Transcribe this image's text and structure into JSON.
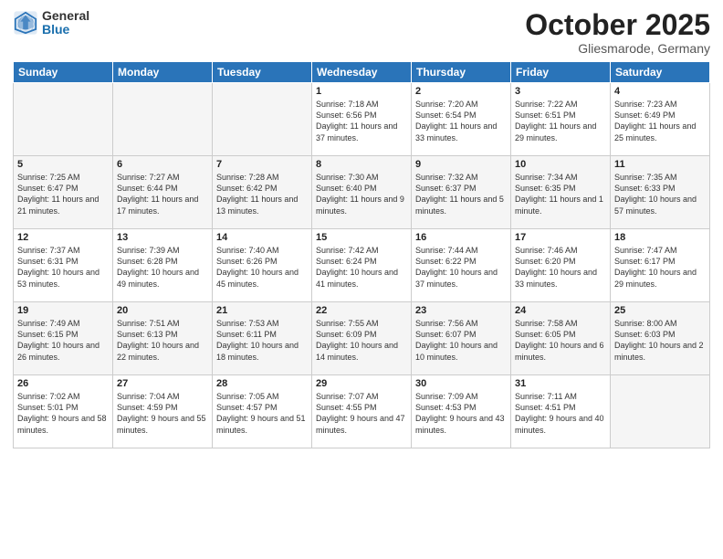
{
  "logo": {
    "general": "General",
    "blue": "Blue"
  },
  "title": "October 2025",
  "location": "Gliesmarode, Germany",
  "days_of_week": [
    "Sunday",
    "Monday",
    "Tuesday",
    "Wednesday",
    "Thursday",
    "Friday",
    "Saturday"
  ],
  "weeks": [
    [
      {
        "day": "",
        "info": "",
        "empty": true
      },
      {
        "day": "",
        "info": "",
        "empty": true
      },
      {
        "day": "",
        "info": "",
        "empty": true
      },
      {
        "day": "1",
        "info": "Sunrise: 7:18 AM\nSunset: 6:56 PM\nDaylight: 11 hours\nand 37 minutes."
      },
      {
        "day": "2",
        "info": "Sunrise: 7:20 AM\nSunset: 6:54 PM\nDaylight: 11 hours\nand 33 minutes."
      },
      {
        "day": "3",
        "info": "Sunrise: 7:22 AM\nSunset: 6:51 PM\nDaylight: 11 hours\nand 29 minutes."
      },
      {
        "day": "4",
        "info": "Sunrise: 7:23 AM\nSunset: 6:49 PM\nDaylight: 11 hours\nand 25 minutes."
      }
    ],
    [
      {
        "day": "5",
        "info": "Sunrise: 7:25 AM\nSunset: 6:47 PM\nDaylight: 11 hours\nand 21 minutes."
      },
      {
        "day": "6",
        "info": "Sunrise: 7:27 AM\nSunset: 6:44 PM\nDaylight: 11 hours\nand 17 minutes."
      },
      {
        "day": "7",
        "info": "Sunrise: 7:28 AM\nSunset: 6:42 PM\nDaylight: 11 hours\nand 13 minutes."
      },
      {
        "day": "8",
        "info": "Sunrise: 7:30 AM\nSunset: 6:40 PM\nDaylight: 11 hours\nand 9 minutes."
      },
      {
        "day": "9",
        "info": "Sunrise: 7:32 AM\nSunset: 6:37 PM\nDaylight: 11 hours\nand 5 minutes."
      },
      {
        "day": "10",
        "info": "Sunrise: 7:34 AM\nSunset: 6:35 PM\nDaylight: 11 hours\nand 1 minute."
      },
      {
        "day": "11",
        "info": "Sunrise: 7:35 AM\nSunset: 6:33 PM\nDaylight: 10 hours\nand 57 minutes."
      }
    ],
    [
      {
        "day": "12",
        "info": "Sunrise: 7:37 AM\nSunset: 6:31 PM\nDaylight: 10 hours\nand 53 minutes."
      },
      {
        "day": "13",
        "info": "Sunrise: 7:39 AM\nSunset: 6:28 PM\nDaylight: 10 hours\nand 49 minutes."
      },
      {
        "day": "14",
        "info": "Sunrise: 7:40 AM\nSunset: 6:26 PM\nDaylight: 10 hours\nand 45 minutes."
      },
      {
        "day": "15",
        "info": "Sunrise: 7:42 AM\nSunset: 6:24 PM\nDaylight: 10 hours\nand 41 minutes."
      },
      {
        "day": "16",
        "info": "Sunrise: 7:44 AM\nSunset: 6:22 PM\nDaylight: 10 hours\nand 37 minutes."
      },
      {
        "day": "17",
        "info": "Sunrise: 7:46 AM\nSunset: 6:20 PM\nDaylight: 10 hours\nand 33 minutes."
      },
      {
        "day": "18",
        "info": "Sunrise: 7:47 AM\nSunset: 6:17 PM\nDaylight: 10 hours\nand 29 minutes."
      }
    ],
    [
      {
        "day": "19",
        "info": "Sunrise: 7:49 AM\nSunset: 6:15 PM\nDaylight: 10 hours\nand 26 minutes."
      },
      {
        "day": "20",
        "info": "Sunrise: 7:51 AM\nSunset: 6:13 PM\nDaylight: 10 hours\nand 22 minutes."
      },
      {
        "day": "21",
        "info": "Sunrise: 7:53 AM\nSunset: 6:11 PM\nDaylight: 10 hours\nand 18 minutes."
      },
      {
        "day": "22",
        "info": "Sunrise: 7:55 AM\nSunset: 6:09 PM\nDaylight: 10 hours\nand 14 minutes."
      },
      {
        "day": "23",
        "info": "Sunrise: 7:56 AM\nSunset: 6:07 PM\nDaylight: 10 hours\nand 10 minutes."
      },
      {
        "day": "24",
        "info": "Sunrise: 7:58 AM\nSunset: 6:05 PM\nDaylight: 10 hours\nand 6 minutes."
      },
      {
        "day": "25",
        "info": "Sunrise: 8:00 AM\nSunset: 6:03 PM\nDaylight: 10 hours\nand 2 minutes."
      }
    ],
    [
      {
        "day": "26",
        "info": "Sunrise: 7:02 AM\nSunset: 5:01 PM\nDaylight: 9 hours\nand 58 minutes."
      },
      {
        "day": "27",
        "info": "Sunrise: 7:04 AM\nSunset: 4:59 PM\nDaylight: 9 hours\nand 55 minutes."
      },
      {
        "day": "28",
        "info": "Sunrise: 7:05 AM\nSunset: 4:57 PM\nDaylight: 9 hours\nand 51 minutes."
      },
      {
        "day": "29",
        "info": "Sunrise: 7:07 AM\nSunset: 4:55 PM\nDaylight: 9 hours\nand 47 minutes."
      },
      {
        "day": "30",
        "info": "Sunrise: 7:09 AM\nSunset: 4:53 PM\nDaylight: 9 hours\nand 43 minutes."
      },
      {
        "day": "31",
        "info": "Sunrise: 7:11 AM\nSunset: 4:51 PM\nDaylight: 9 hours\nand 40 minutes."
      },
      {
        "day": "",
        "info": "",
        "empty": true
      }
    ]
  ]
}
